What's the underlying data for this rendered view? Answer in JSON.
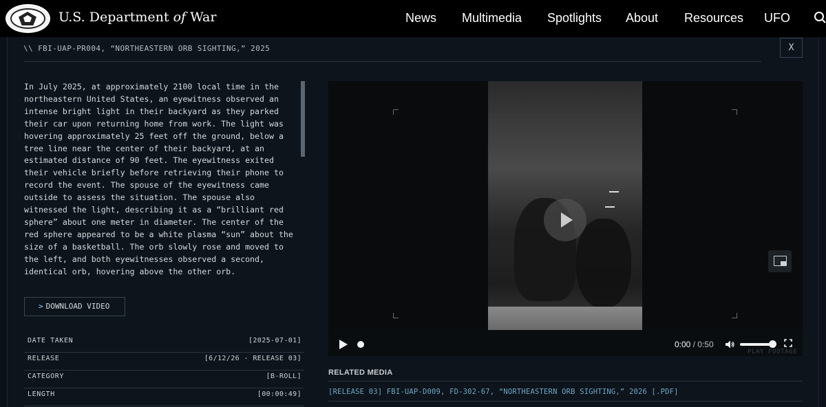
{
  "header": {
    "brand_prefix": "U.S. Department ",
    "brand_of": "of",
    "brand_suffix": " War",
    "nav": [
      "News",
      "Multimedia",
      "Spotlights",
      "About",
      "Resources",
      "UFO"
    ],
    "search_icon": "search-icon"
  },
  "record": {
    "breadcrumb": "\\\\  FBI-UAP-PR004, “NORTHEASTERN ORB SIGHTING,” 2025",
    "close_label": "X",
    "description": "In July 2025, at approximately 2100 local time in the northeastern United States, an eyewitness observed an intense bright light in their backyard as they parked their car upon returning home from work. The light was hovering approximately 25 feet off the ground, below a tree line near the center of their backyard, at an estimated distance of 90 feet. The eyewitness exited their vehicle briefly before retrieving their phone to record the event. The spouse of the eyewitness came outside to assess the situation. The spouse also witnessed the light, describing it as a “brilliant red sphere” about one meter in diameter. The center of the red sphere appeared to be a white plasma “sun” about the size of a basketball. The orb slowly rose and moved to the left, and both eyewitnesses observed a second, identical orb, hovering above the other orb.",
    "download_chevron": ">",
    "download_label": "DOWNLOAD VIDEO",
    "meta": [
      {
        "key": "DATE TAKEN",
        "value": "[2025-07-01]"
      },
      {
        "key": "RELEASE",
        "value": "[6/12/26 - RELEASE 03]"
      },
      {
        "key": "CATEGORY",
        "value": "[B-ROLL]"
      },
      {
        "key": "LENGTH",
        "value": "[00:00:49]"
      }
    ]
  },
  "player": {
    "current_time": "0:00",
    "separator": " / ",
    "duration": "0:50",
    "progress": 0,
    "volume": 0.9,
    "watermark": "PLAY FOOTAGE"
  },
  "related": {
    "heading": "RELATED MEDIA",
    "items": [
      "[RELEASE 03] FBI-UAP-D009, FD-302-67, “NORTHEASTERN ORB SIGHTING,” 2026 [.PDF]"
    ]
  },
  "colors": {
    "background": "#0b1117",
    "header": "#000000",
    "link": "#6fa7c4"
  }
}
